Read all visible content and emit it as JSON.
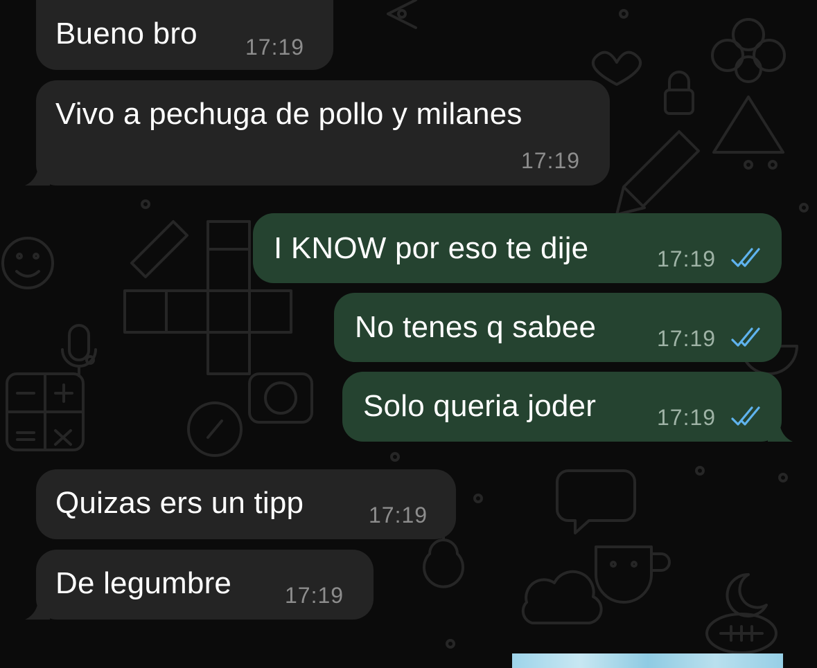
{
  "conversation": {
    "messages": [
      {
        "id": "m1",
        "direction": "incoming",
        "text": "Bueno bro",
        "time": "17:19"
      },
      {
        "id": "m2",
        "direction": "incoming",
        "text": "Vivo a pechuga de pollo y milanes",
        "time": "17:19"
      },
      {
        "id": "m3",
        "direction": "outgoing",
        "text": "I KNOW por eso te dije",
        "time": "17:19",
        "status_icon": "double-check-read-icon"
      },
      {
        "id": "m4",
        "direction": "outgoing",
        "text": "No tenes q sabee",
        "time": "17:19",
        "status_icon": "double-check-read-icon"
      },
      {
        "id": "m5",
        "direction": "outgoing",
        "text": "Solo queria joder",
        "time": "17:19",
        "status_icon": "double-check-read-icon"
      },
      {
        "id": "m6",
        "direction": "incoming",
        "text": "Quizas ers un tipp",
        "time": "17:19"
      },
      {
        "id": "m7",
        "direction": "incoming",
        "text": "De legumbre",
        "time": "17:19"
      }
    ],
    "media_preview": {
      "icon": "image-thumbnail"
    }
  },
  "colors": {
    "background": "#0b0b0b",
    "incoming_bubble": "#242424",
    "outgoing_bubble": "#254330",
    "read_ticks": "#5fb3ee",
    "wallpaper_doodle": "#2a2a2a"
  }
}
